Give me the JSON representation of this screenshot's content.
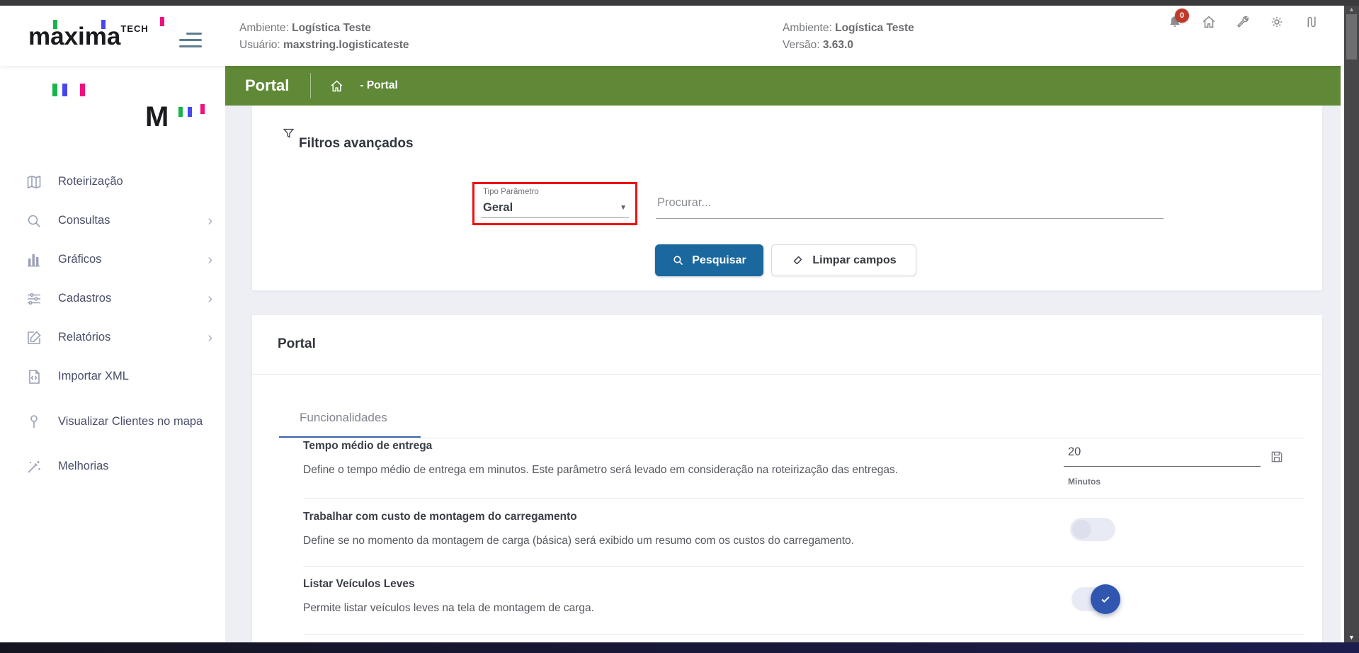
{
  "header": {
    "brand": {
      "name": "maxima",
      "suffix": "TECH"
    },
    "info_left": {
      "ambiente_label": "Ambiente:",
      "ambiente_value": "Logística Teste",
      "usuario_label": "Usuário:",
      "usuario_value": "maxstring.logisticateste"
    },
    "info_right": {
      "ambiente_label": "Ambiente:",
      "ambiente_value": "Logística Teste",
      "versao_label": "Versão:",
      "versao_value": "3.63.0"
    },
    "notification_badge": "0"
  },
  "sidebar": {
    "items": [
      {
        "label": "Roteirização"
      },
      {
        "label": "Consultas"
      },
      {
        "label": "Gráficos"
      },
      {
        "label": "Cadastros"
      },
      {
        "label": "Relatórios"
      },
      {
        "label": "Importar XML"
      },
      {
        "label": "Visualizar Clientes no mapa"
      },
      {
        "label": "Melhorias"
      }
    ],
    "chevron": "›"
  },
  "pagebar": {
    "title": "Portal",
    "breadcrumb": "- Portal"
  },
  "filters": {
    "title": "Filtros avançados",
    "tipo_label": "Tipo Parâmetro",
    "tipo_value": "Geral",
    "caret": "▼",
    "search_placeholder": "Procurar...",
    "search_button": "Pesquisar",
    "clear_button": "Limpar campos"
  },
  "portal": {
    "title": "Portal",
    "tab": "Funcionalidades",
    "rows": [
      {
        "title": "Tempo médio de entrega",
        "description": "Define o tempo médio de entrega em minutos. Este parâmetro será levado em consideração na roteirização das entregas.",
        "value": "20",
        "unit": "Minutos"
      },
      {
        "title": "Trabalhar com custo de montagem do carregamento",
        "description": "Define se no momento da montagem de carga (básica) será exibido um resumo com os custos do carregamento.",
        "toggle": "off"
      },
      {
        "title": "Listar Veículos Leves",
        "description": "Permite listar veículos leves na tela de montagem de carga.",
        "toggle": "on"
      }
    ]
  },
  "scrollbar": {
    "up_arrow": "▲",
    "down_arrow": "▼"
  },
  "colors": {
    "green": "#5f8936",
    "primary_blue": "#1b689e",
    "toggle_blue": "#3156b0",
    "tab_blue": "#3d63ac",
    "badge_red": "#bf3a29",
    "highlight_red": "#ee1111"
  }
}
